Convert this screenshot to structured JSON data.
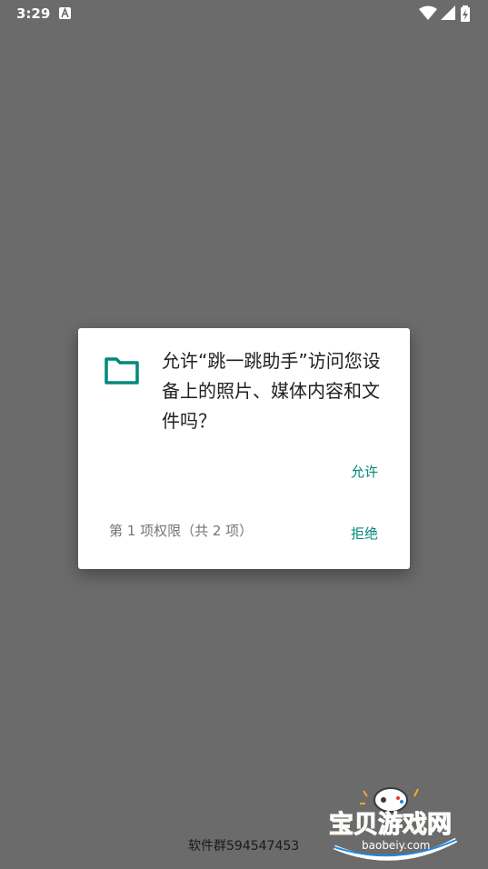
{
  "status_bar": {
    "time": "3:29",
    "app_icon": "text-a-icon",
    "icons": [
      "wifi-icon",
      "signal-icon",
      "battery-charging-icon"
    ]
  },
  "dialog": {
    "icon": "folder-icon",
    "message": "允许“跳一跳助手”访问您设备上的照片、媒体内容和文件吗？",
    "allow_label": "允许",
    "deny_label": "拒绝",
    "counter": "第 1 项权限（共 2 项）"
  },
  "footer": {
    "text": "软件群594547453"
  },
  "watermark": {
    "title": "宝贝游戏网",
    "url": "baobeiy.com"
  },
  "colors": {
    "scrim": "#6b6b6b",
    "accent": "#00897b",
    "dialog_bg": "#ffffff"
  }
}
